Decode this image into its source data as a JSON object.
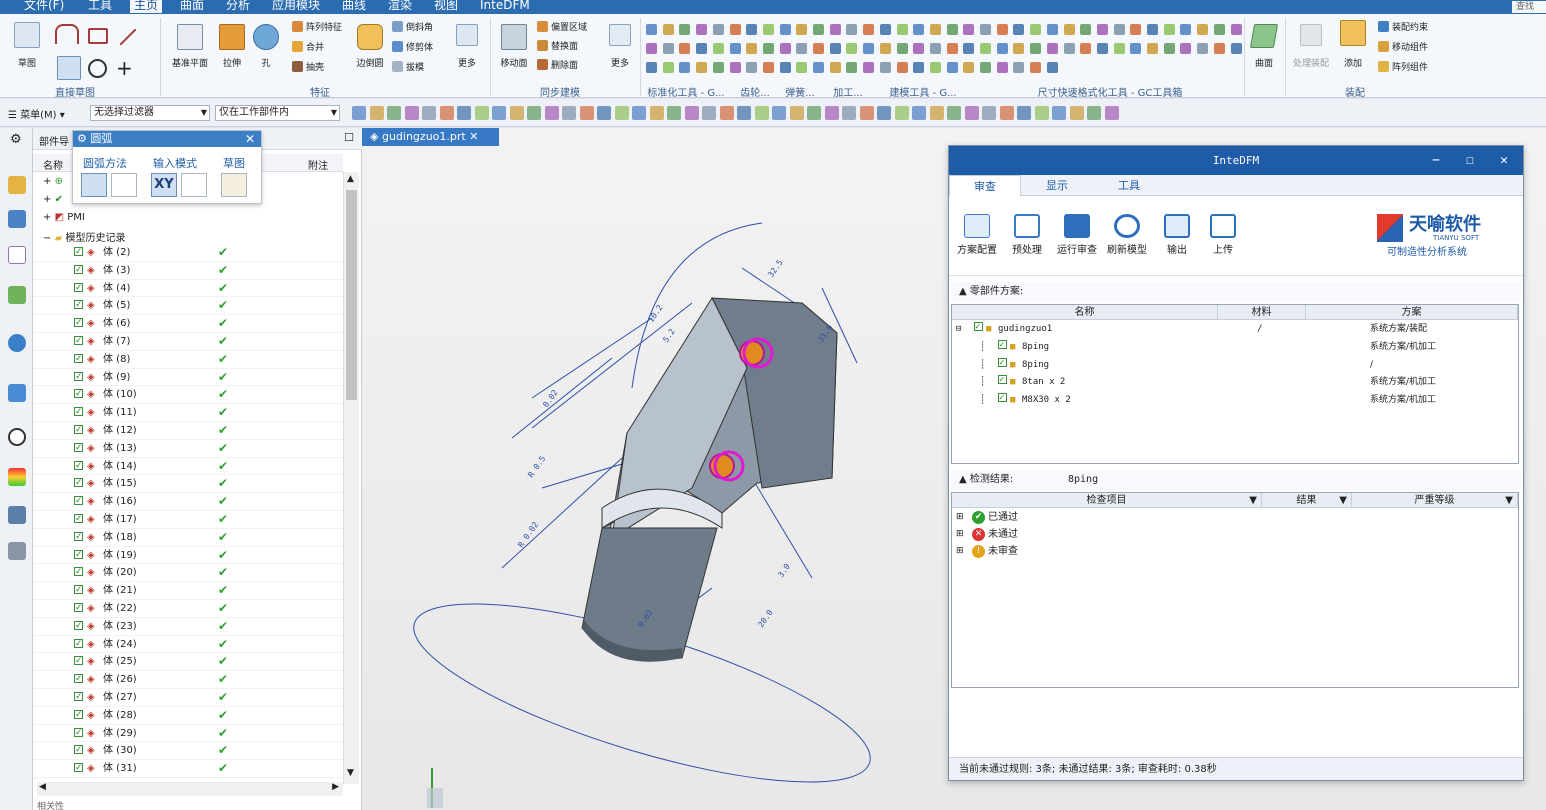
{
  "menu": [
    "文件(F)",
    "工具",
    "主页",
    "曲面",
    "分析",
    "应用模块",
    "曲线",
    "渲染",
    "视图",
    "InteDFM"
  ],
  "menu_active": 2,
  "search_label": "查找命",
  "ribbon": {
    "groups": [
      "直接草图",
      "特征",
      "同步建模",
      "标准化工具 - G...",
      "齿轮...",
      "弹簧...",
      "加工...",
      "建模工具 - G...",
      "尺寸快速格式化工具 - GC工具箱",
      "装配"
    ],
    "sketch_label": "草图",
    "datum_label": "基准平面",
    "extrude_label": "拉伸",
    "hole_label": "孔",
    "feature_items": [
      "阵列特征",
      "合并",
      "抽壳",
      "倒斜角",
      "修剪体",
      "拔模"
    ],
    "edge_blend_label": "边倒圆",
    "more_label": "更多",
    "move_face_label": "移动面",
    "sync_items": [
      "偏置区域",
      "替换面",
      "删除面"
    ],
    "surface_label": "曲面",
    "assembly_items": [
      "处理装配",
      "添加",
      "装配约束",
      "移动组件",
      "阵列组件"
    ]
  },
  "toolbar2": {
    "menu_label": "菜单(M)",
    "filter": "无选择过滤器",
    "scope": "仅在工作部件内"
  },
  "nav": {
    "title": "部件导",
    "col_name": "名称",
    "col_note": "附注",
    "pmi": "PMI",
    "history": "模型历史记录",
    "bodies": [
      "体 (2)",
      "体 (3)",
      "体 (4)",
      "体 (5)",
      "体 (6)",
      "体 (7)",
      "体 (8)",
      "体 (9)",
      "体 (10)",
      "体 (11)",
      "体 (12)",
      "体 (13)",
      "体 (14)",
      "体 (15)",
      "体 (16)",
      "体 (17)",
      "体 (18)",
      "体 (19)",
      "体 (20)",
      "体 (21)",
      "体 (22)",
      "体 (23)",
      "体 (24)",
      "体 (25)",
      "体 (26)",
      "体 (27)",
      "体 (28)",
      "体 (29)",
      "体 (30)",
      "体 (31)"
    ],
    "bottom_label": "相关性"
  },
  "arc_dialog": {
    "title": "圆弧",
    "sections": [
      "圆弧方法",
      "输入模式",
      "草图"
    ],
    "xy_label": "XY"
  },
  "viewport": {
    "tab_label": "gudingzuo1.prt",
    "dims": [
      "R 0.5",
      "10.2",
      "5.2",
      "31.0",
      "0.02",
      "32.5",
      "R 0.02",
      "3.0",
      "0.02",
      "20.0"
    ]
  },
  "dfm": {
    "title": "InteDFM",
    "tabs": [
      "审查",
      "显示",
      "工具"
    ],
    "tools": [
      "方案配置",
      "预处理",
      "运行审查",
      "刷新模型",
      "输出",
      "上传"
    ],
    "brand_name": "天喻软件",
    "brand_en": "TIANYU SOFT",
    "brand_sub": "可制造性分析系统",
    "parts_section": "零部件方案:",
    "parts_headers": [
      "名称",
      "材料",
      "方案"
    ],
    "parts": [
      {
        "name": "gudingzuo1",
        "material": "/",
        "scheme": "系统方案/装配"
      },
      {
        "name": "8ping",
        "material": "",
        "scheme": "系统方案/机加工"
      },
      {
        "name": "8ping",
        "material": "",
        "scheme": "/"
      },
      {
        "name": "8tan x 2",
        "material": "",
        "scheme": "系统方案/机加工"
      },
      {
        "name": "M8X30 x 2",
        "material": "",
        "scheme": "系统方案/机加工"
      }
    ],
    "results_section": "检测结果:",
    "results_part": "8ping",
    "results_headers": [
      "检查项目",
      "结果",
      "严重等级"
    ],
    "results": [
      "已通过",
      "未通过",
      "未审查"
    ],
    "status": "当前未通过规则: 3条; 未通过结果: 3条; 审查耗时: 0.38秒"
  }
}
